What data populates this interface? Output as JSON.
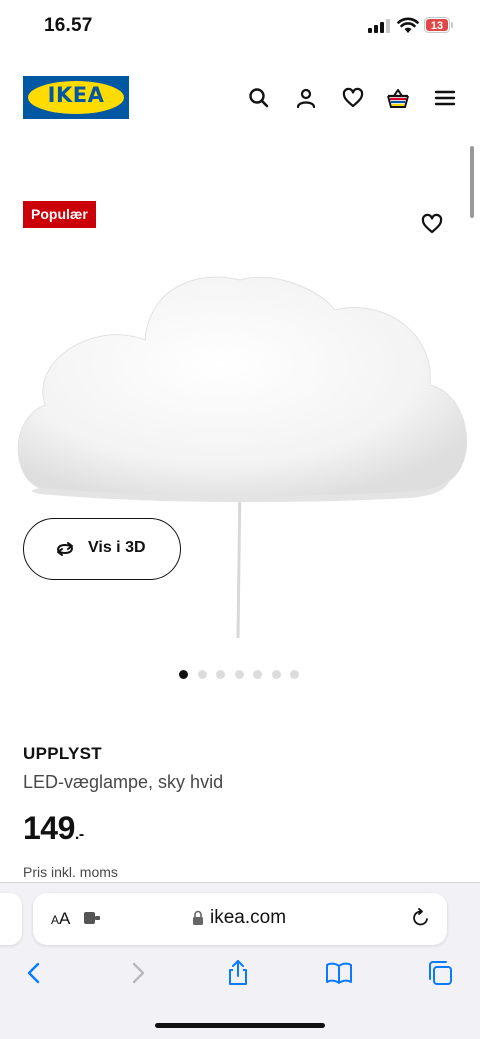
{
  "status_bar": {
    "time": "16.57",
    "battery": "13"
  },
  "header": {
    "logo": "IKEA",
    "icons": [
      "search-icon",
      "account-icon",
      "heart-icon",
      "basket-icon",
      "menu-icon"
    ],
    "brand_blue": "#0058a3",
    "brand_yellow": "#ffdb00"
  },
  "product": {
    "badge": "Populær",
    "badge_color": "#cc0008",
    "view_3d_label": "Vis i 3D",
    "image_count": 7,
    "active_image": 1,
    "name": "UPPLYST",
    "description": "LED-væglampe, sky hvid",
    "price": "149",
    "price_suffix": ".-",
    "vat_note": "Pris inkl. moms"
  },
  "browser": {
    "text_size": {
      "small": "A",
      "large": "A"
    },
    "url": "ikea.com",
    "toolbar": [
      "back-icon",
      "forward-icon",
      "share-icon",
      "bookmarks-icon",
      "tabs-icon"
    ],
    "accent": "#0a7aff"
  }
}
